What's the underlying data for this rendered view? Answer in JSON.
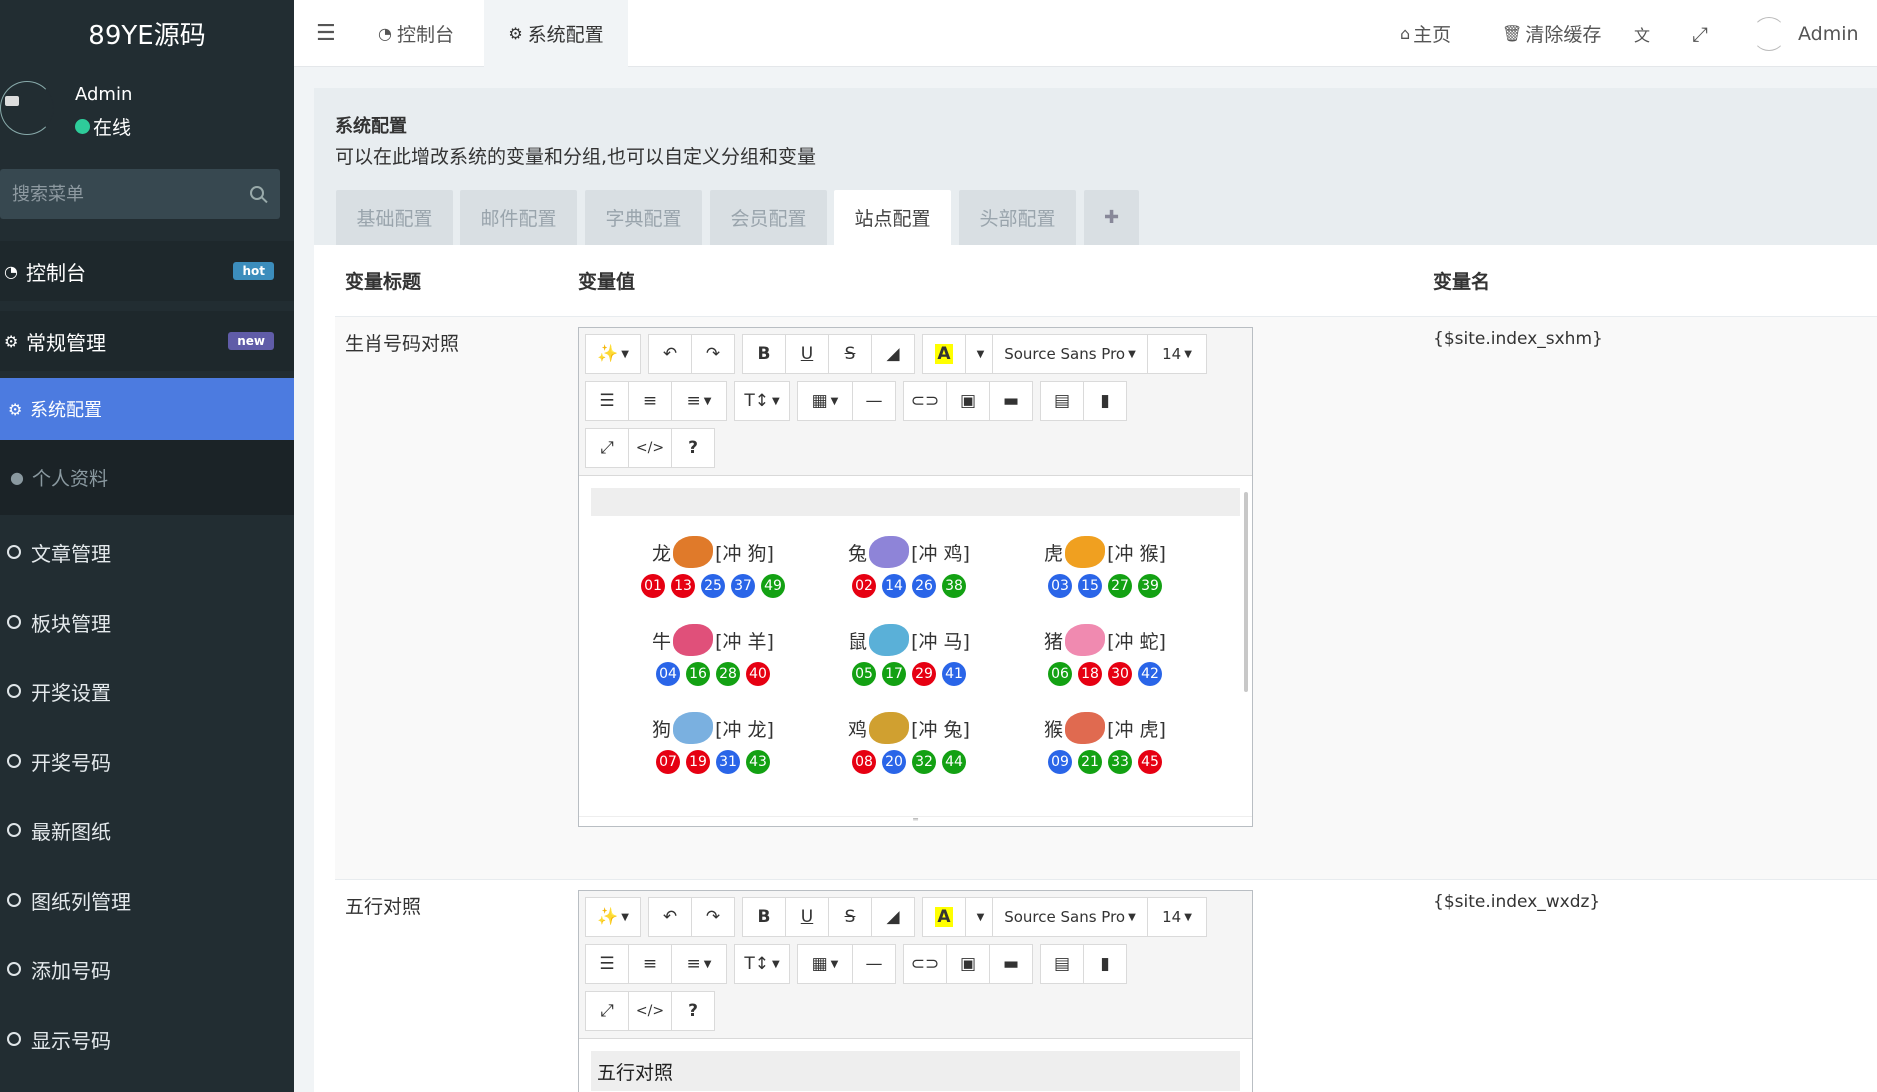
{
  "app": {
    "logo": "89YE源码"
  },
  "user": {
    "name": "Admin",
    "status": "在线"
  },
  "sidebar": {
    "search_placeholder": "搜索菜单",
    "dashboard": {
      "label": "控制台",
      "badge": "hot",
      "badge_color": "#3c8dbc"
    },
    "general": {
      "label": "常规管理",
      "badge": "new",
      "badge_color": "#605ca8"
    },
    "sysconfig": {
      "label": "系统配置"
    },
    "profile": {
      "label": "个人资料"
    },
    "items": [
      "文章管理",
      "板块管理",
      "开奖设置",
      "开奖号码",
      "最新图纸",
      "图纸列管理",
      "添加号码",
      "显示号码"
    ]
  },
  "topbar": {
    "tabs": [
      "控制台",
      "系统配置"
    ],
    "home": "主页",
    "clear_cache": "清除缓存",
    "admin": "Admin"
  },
  "panel": {
    "title": "系统配置",
    "description": "可以在此增改系统的变量和分组,也可以自定义分组和变量",
    "tabs": [
      "基础配置",
      "邮件配置",
      "字典配置",
      "会员配置",
      "站点配置",
      "头部配置",
      "✚"
    ],
    "active_tab": "站点配置"
  },
  "table": {
    "headers": {
      "title": "变量标题",
      "value": "变量值",
      "name": "变量名"
    },
    "rows": [
      {
        "title": "生肖号码对照",
        "var": "{$site.index_sxhm}"
      },
      {
        "title": "五行对照",
        "var": "{$site.index_wxdz}"
      }
    ]
  },
  "editor": {
    "font": "Source Sans Pro",
    "size": "14"
  },
  "zodiac": [
    {
      "name": "龙",
      "clash": "[冲 狗]",
      "color": "#e07a2a",
      "balls": [
        [
          "01",
          "red"
        ],
        [
          "13",
          "red"
        ],
        [
          "25",
          "blue"
        ],
        [
          "37",
          "blue"
        ],
        [
          "49",
          "green"
        ]
      ]
    },
    {
      "name": "兔",
      "clash": "[冲 鸡]",
      "color": "#8e84d8",
      "balls": [
        [
          "02",
          "red"
        ],
        [
          "14",
          "blue"
        ],
        [
          "26",
          "blue"
        ],
        [
          "38",
          "green"
        ]
      ]
    },
    {
      "name": "虎",
      "clash": "[冲 猴]",
      "color": "#f0a020",
      "balls": [
        [
          "03",
          "blue"
        ],
        [
          "15",
          "blue"
        ],
        [
          "27",
          "green"
        ],
        [
          "39",
          "green"
        ]
      ]
    },
    {
      "name": "牛",
      "clash": "[冲 羊]",
      "color": "#e0507a",
      "balls": [
        [
          "04",
          "blue"
        ],
        [
          "16",
          "green"
        ],
        [
          "28",
          "green"
        ],
        [
          "40",
          "red"
        ]
      ]
    },
    {
      "name": "鼠",
      "clash": "[冲 马]",
      "color": "#5ab0d8",
      "balls": [
        [
          "05",
          "green"
        ],
        [
          "17",
          "green"
        ],
        [
          "29",
          "red"
        ],
        [
          "41",
          "blue"
        ]
      ]
    },
    {
      "name": "猪",
      "clash": "[冲 蛇]",
      "color": "#f08ab0",
      "balls": [
        [
          "06",
          "green"
        ],
        [
          "18",
          "red"
        ],
        [
          "30",
          "red"
        ],
        [
          "42",
          "blue"
        ]
      ]
    },
    {
      "name": "狗",
      "clash": "[冲 龙]",
      "color": "#7ab0e0",
      "balls": [
        [
          "07",
          "red"
        ],
        [
          "19",
          "red"
        ],
        [
          "31",
          "blue"
        ],
        [
          "43",
          "green"
        ]
      ]
    },
    {
      "name": "鸡",
      "clash": "[冲 兔]",
      "color": "#d0a030",
      "balls": [
        [
          "08",
          "red"
        ],
        [
          "20",
          "blue"
        ],
        [
          "32",
          "green"
        ],
        [
          "44",
          "green"
        ]
      ]
    },
    {
      "name": "猴",
      "clash": "[冲 虎]",
      "color": "#e06a50",
      "balls": [
        [
          "09",
          "blue"
        ],
        [
          "21",
          "green"
        ],
        [
          "33",
          "green"
        ],
        [
          "45",
          "red"
        ]
      ]
    }
  ],
  "wuxing_preview": "五行对照"
}
